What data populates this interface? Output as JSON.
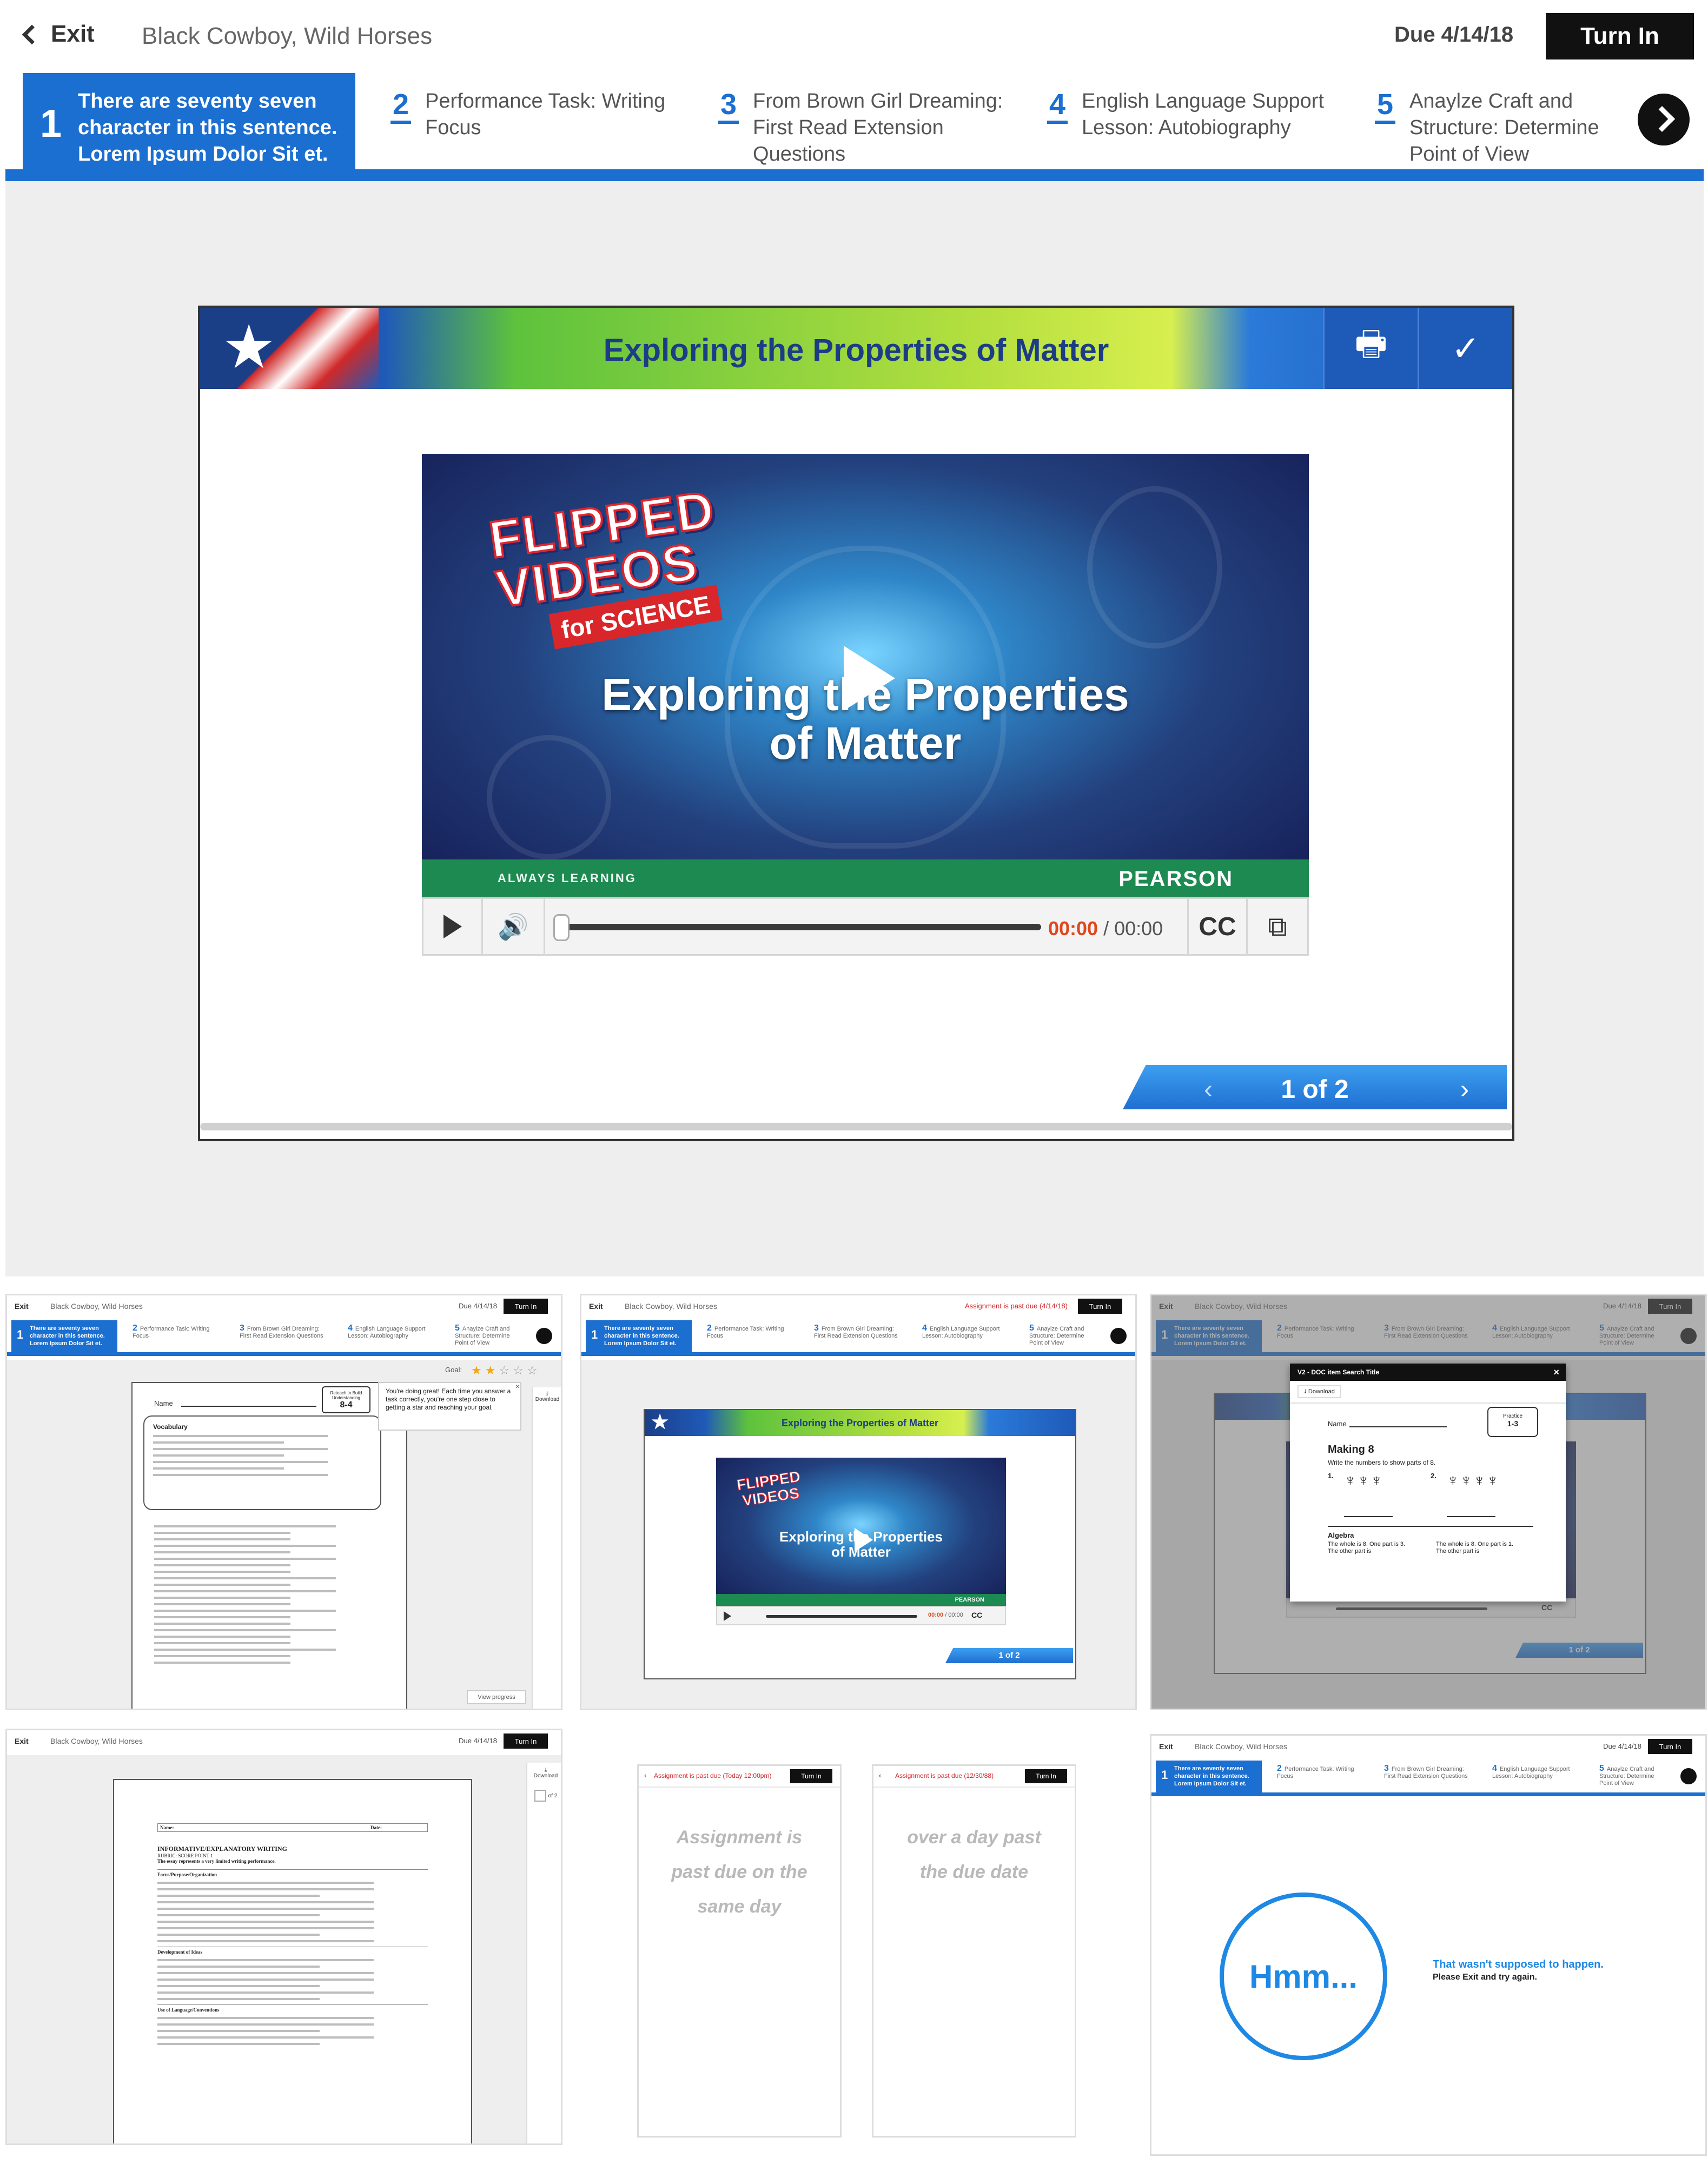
{
  "main": {
    "exit_label": "Exit",
    "assignment_title": "Black Cowboy, Wild Horses",
    "due": "Due 4/14/18",
    "turn_in": "Turn In",
    "tasks": [
      {
        "num": "1",
        "label": "There are seventy seven character in this sentence. Lorem Ipsum Dolor Sit et."
      },
      {
        "num": "2",
        "label": "Performance Task: Writing Focus"
      },
      {
        "num": "3",
        "label": "From Brown Girl Dreaming: First Read Extension Questions"
      },
      {
        "num": "4",
        "label": "English Language Support Lesson: Autobiography"
      },
      {
        "num": "5",
        "label": "Anaylze Craft and Structure: Determine Point of View"
      }
    ],
    "slide_title": "Exploring the Properties of Matter",
    "video": {
      "logo_line1": "FLIPPED",
      "logo_line2": "VIDEOS",
      "logo_line3": "for SCIENCE",
      "title_line1": "Exploring the Properties",
      "title_line2": "of Matter",
      "band_left": "ALWAYS LEARNING",
      "band_right": "PEARSON",
      "time_current": "00:00",
      "time_total": " / 00:00",
      "cc": "CC",
      "progress": 0
    },
    "pager": "1 of 2"
  },
  "thumb1": {
    "goal": "Goal:",
    "stars_filled": 2,
    "stars_total": 5,
    "tooltip": "You're doing great! Each time you answer a task correctly, you're one step close to getting a star and reaching your goal.",
    "download": "Download",
    "view_progress": "View progress",
    "badge_top": "Reteach to Build Understanding",
    "badge_num": "8-4",
    "name_label": "Name",
    "vocab": "Vocabulary"
  },
  "thumb2": {
    "past_due": "Assignment is past due (4/14/18)"
  },
  "thumb3": {
    "modal_title": "V2 - DOC item Search Title",
    "download": "Download",
    "practice": "Practice",
    "practice_num": "1-3",
    "heading": "Making 8",
    "instructions": "Write the numbers to show parts of 8.",
    "algebra": "Algebra",
    "alg3": "The whole is 8. One part is 3. The other part is",
    "alg4": "The whole is 8. One part is 1. The other part is"
  },
  "thumb4": {
    "doc_heading": "INFORMATIVE/EXPLANATORY WRITING",
    "doc_sub": "RUBRIC: SCORE POINT 1",
    "doc_sub2": "The essay represents a very limited writing performance.",
    "sec1": "Focus/Purpose/Organization",
    "sec2": "Development of Ideas",
    "sec3": "Use of Language/Conventions",
    "name": "Name:",
    "date": "Date:",
    "page_of": "of 2"
  },
  "thumb5": {
    "past_due": "Assignment is past due (Today 12:00pm)",
    "message": "Assignment is past due on the same day"
  },
  "thumb6": {
    "past_due": "Assignment is past due (12/30/88)",
    "message": "over a day past the due date"
  },
  "thumb7": {
    "hmm": "Hmm...",
    "error_title": "That wasn't supposed to happen.",
    "error_sub": "Please Exit and try again."
  },
  "colors": {
    "accent": "#1a6fd0",
    "danger": "#d1252a",
    "orange_time": "#e0471c",
    "pearson_green": "#1d8a52"
  }
}
